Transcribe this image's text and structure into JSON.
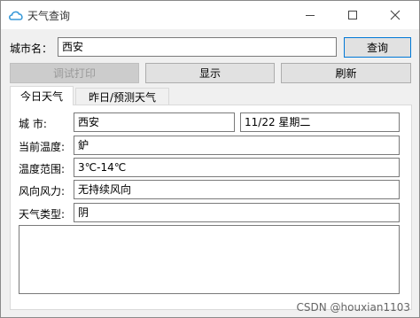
{
  "window": {
    "title": "天气查询",
    "minimize_icon": "minimize-icon",
    "maximize_icon": "maximize-icon",
    "close_icon": "close-icon"
  },
  "search": {
    "city_label": "城市名：",
    "city_value": "西安",
    "query_button": "查询"
  },
  "toolbar": {
    "debug_print": "调试打印",
    "show": "显示",
    "refresh": "刷新"
  },
  "tabs": [
    {
      "label": "今日天气",
      "active": true
    },
    {
      "label": "昨日/预测天气",
      "active": false
    }
  ],
  "today": {
    "city_label": "城      市:",
    "city_value": "西安",
    "date_value": "11/22   星期二",
    "current_temp_label": "当前温度:",
    "current_temp_value": "鈩",
    "temp_range_label": "温度范围:",
    "temp_range_value": "3℃-14℃",
    "wind_label": "风向风力:",
    "wind_value": "无持续风向",
    "type_label": "天气类型:",
    "type_value": "阴",
    "notes_value": ""
  },
  "watermark": "CSDN @houxian1103"
}
